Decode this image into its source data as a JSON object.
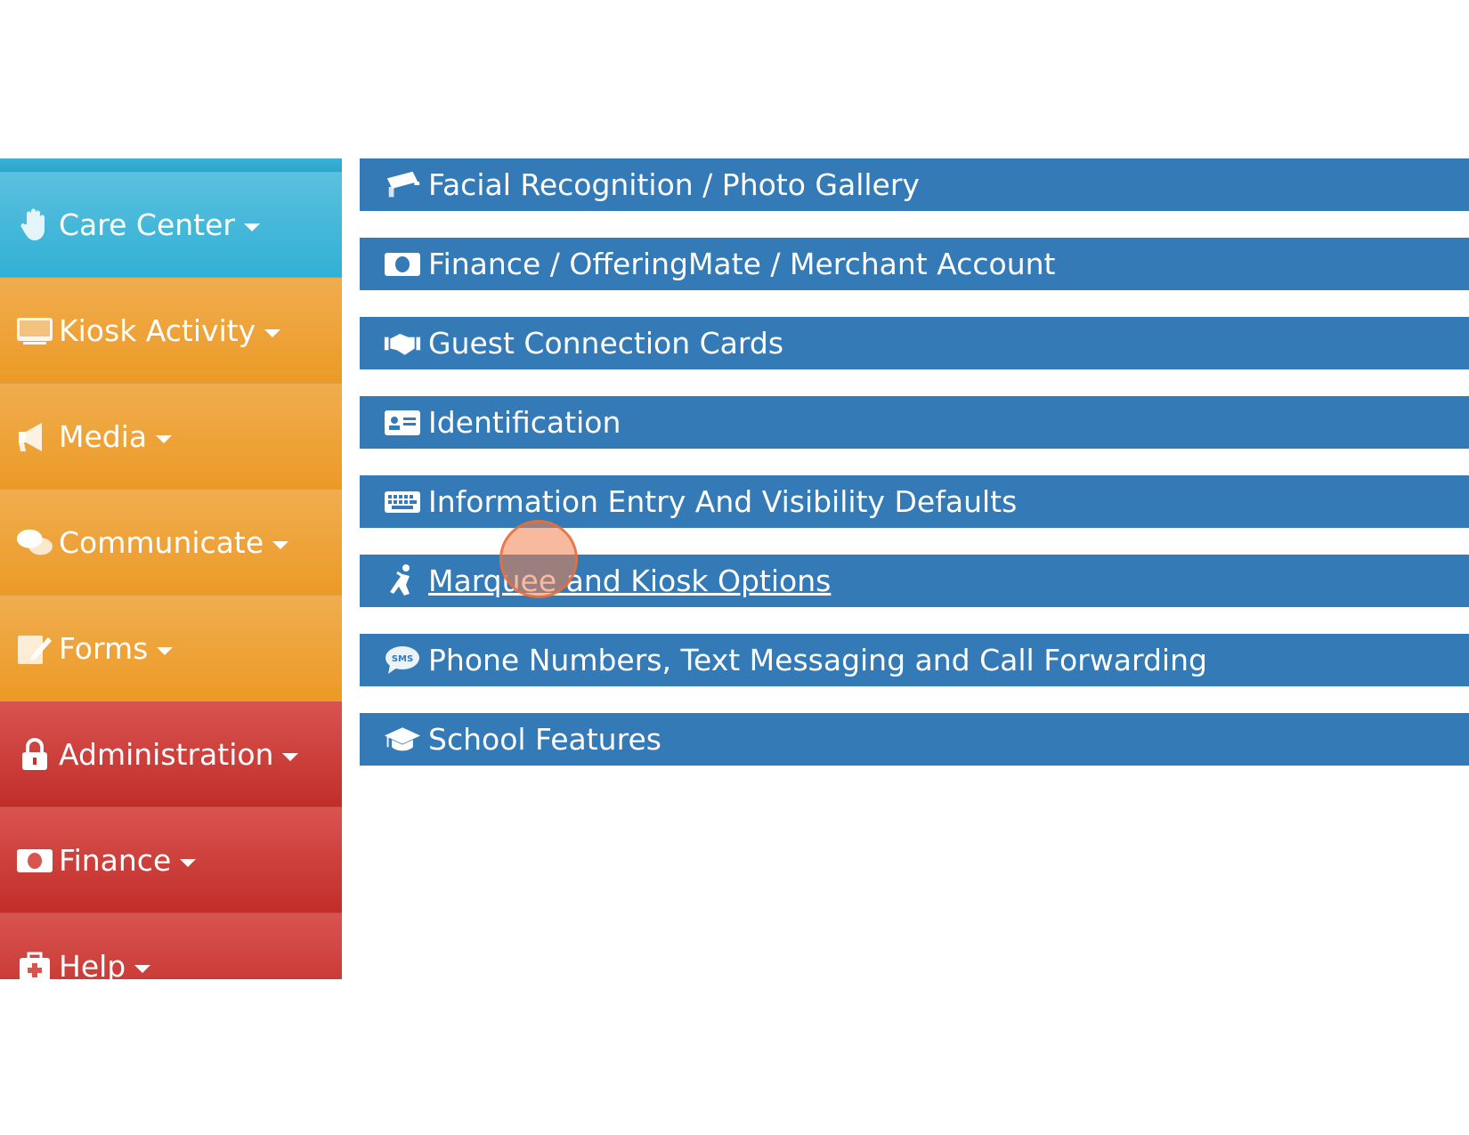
{
  "sidebar": {
    "items": [
      {
        "label": "Care Center",
        "icon": "hand-icon",
        "color": "#5bc0de"
      },
      {
        "label": "Kiosk Activity",
        "icon": "monitor-icon",
        "color": "#f0ad4e"
      },
      {
        "label": "Media",
        "icon": "bullhorn-icon",
        "color": "#f0ad4e"
      },
      {
        "label": "Communicate",
        "icon": "chat-bubbles-icon",
        "color": "#f0ad4e"
      },
      {
        "label": "Forms",
        "icon": "edit-form-icon",
        "color": "#f0ad4e"
      },
      {
        "label": "Administration",
        "icon": "lock-icon",
        "color": "#d9534f"
      },
      {
        "label": "Finance",
        "icon": "money-icon",
        "color": "#d9534f"
      },
      {
        "label": "Help",
        "icon": "medkit-icon",
        "color": "#d9534f"
      }
    ]
  },
  "settings": {
    "rows": [
      {
        "label": "Facial Recognition / Photo Gallery",
        "icon": "camera-icon"
      },
      {
        "label": "Finance / OfferingMate / Merchant Account",
        "icon": "money-icon"
      },
      {
        "label": "Guest Connection Cards",
        "icon": "handshake-icon"
      },
      {
        "label": "Identification",
        "icon": "id-card-icon"
      },
      {
        "label": "Information Entry And Visibility Defaults",
        "icon": "keyboard-icon"
      },
      {
        "label": "Marquee and Kiosk Options",
        "icon": "kneeling-person-icon"
      },
      {
        "label": "Phone Numbers, Text Messaging and Call Forwarding",
        "icon": "sms-icon"
      },
      {
        "label": "School Features",
        "icon": "graduation-cap-icon"
      }
    ],
    "row_color": "#337ab7"
  }
}
